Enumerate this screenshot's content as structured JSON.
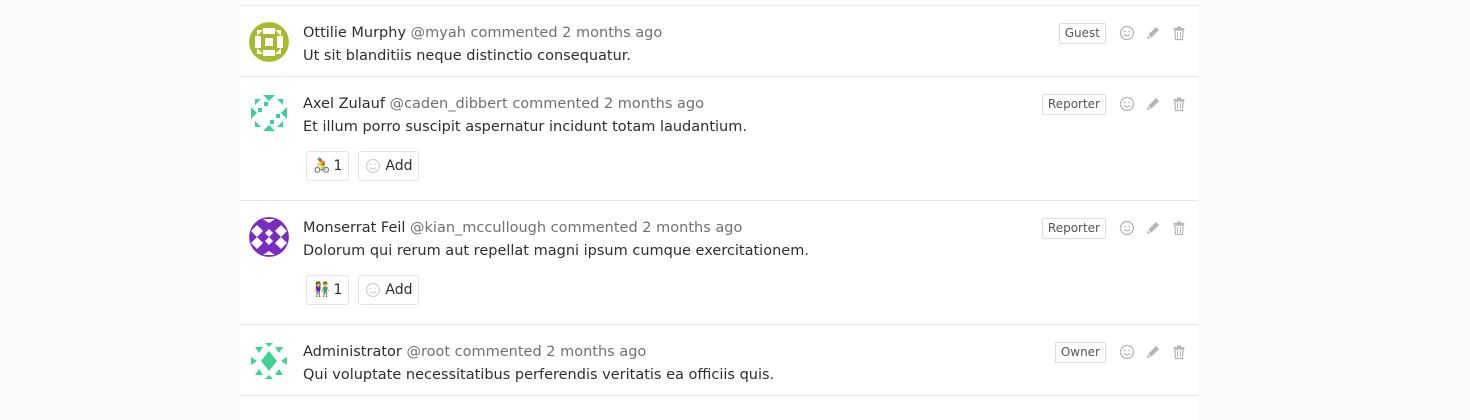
{
  "notes": [
    {
      "author": "Ottilie Murphy",
      "username": "@myah",
      "action": "commented",
      "time": "2 months ago",
      "body": "Ut sit blanditiis neque distinctio consequatur.",
      "role": "Guest",
      "avatar_color": "#a8b832"
    },
    {
      "author": "Axel Zulauf",
      "username": "@caden_dibbert",
      "action": "commented",
      "time": "2 months ago",
      "body": "Et illum porro suscipit aspernatur incidunt totam laudantium.",
      "role": "Reporter",
      "avatar_color": "#3ccf9b",
      "award": {
        "emoji": "🚴",
        "count": "1"
      },
      "add_label": "Add"
    },
    {
      "author": "Monserrat Feil",
      "username": "@kian_mccullough",
      "action": "commented",
      "time": "2 months ago",
      "body": "Dolorum qui rerum aut repellat magni ipsum cumque exercitationem.",
      "role": "Reporter",
      "avatar_color": "#7b2cc0",
      "award": {
        "emoji": "👫",
        "count": "1"
      },
      "add_label": "Add"
    },
    {
      "author": "Administrator",
      "username": "@root",
      "action": "commented",
      "time": "2 months ago",
      "body": "Qui voluptate necessitatibus perferendis veritatis ea officiis quis.",
      "role": "Owner",
      "avatar_color": "#3fd38f"
    }
  ],
  "icons": {
    "smile": "smiley-icon",
    "edit": "pencil-icon",
    "delete": "trash-icon"
  }
}
